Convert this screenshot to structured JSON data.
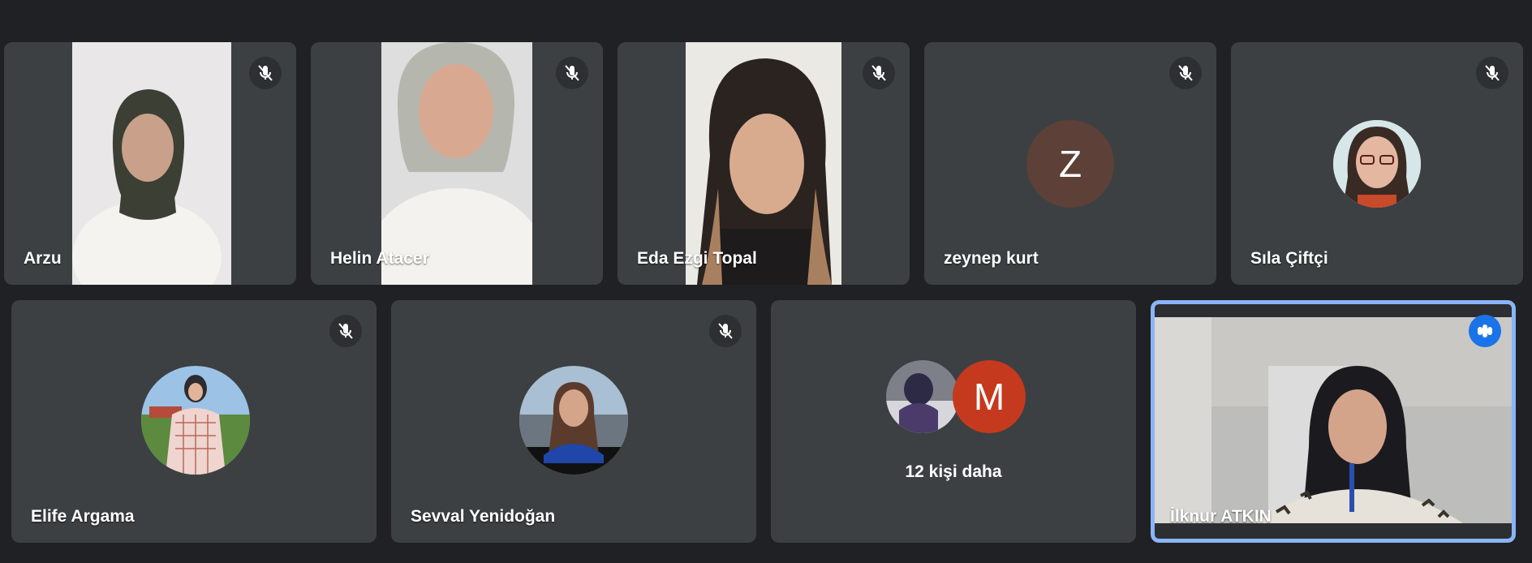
{
  "participants_row1": [
    {
      "name": "Arzu",
      "muted": true
    },
    {
      "name": "Helin Atacer",
      "muted": true
    },
    {
      "name": "Eda Ezgi Topal",
      "muted": true
    },
    {
      "name": "zeynep kurt",
      "muted": true,
      "initial": "Z",
      "avatar_color": "#5d4037"
    },
    {
      "name": "Sıla Çiftçi",
      "muted": true
    }
  ],
  "participants_row2": [
    {
      "name": "Elife Argama",
      "muted": true
    },
    {
      "name": "Sevval Yenidoğan",
      "muted": true
    },
    {
      "more_label": "12 kişi daha",
      "initial": "M",
      "avatar_color": "#c5391e"
    },
    {
      "name": "İlknur ATKIN",
      "speaking": true,
      "active": true
    }
  ],
  "colors": {
    "background": "#202124",
    "tile": "#3c4043",
    "active_border": "#8ab4f8",
    "speaking_badge": "#1a73e8"
  },
  "icons": {
    "mute": "mic-off-icon",
    "speaking": "audio-level-icon"
  }
}
